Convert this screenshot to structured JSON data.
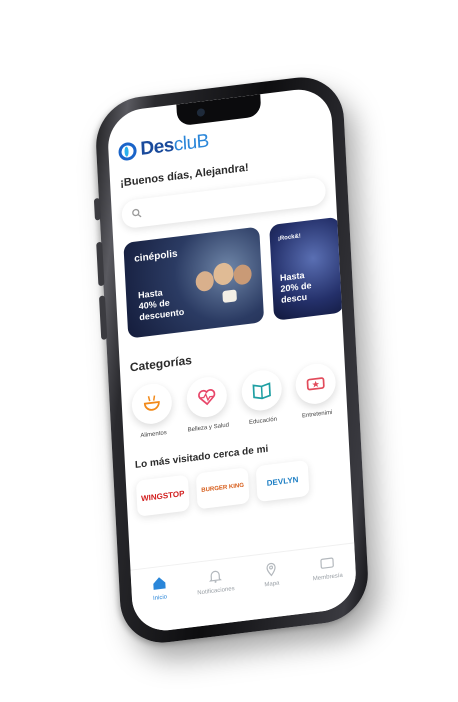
{
  "app": {
    "logo_bold": "Des",
    "logo_light": "cluB"
  },
  "greeting": "¡Buenos días, Alejandra!",
  "promos": [
    {
      "brand": "cinépolis",
      "line1": "Hasta",
      "line2": "40% de",
      "line3": "descuento"
    },
    {
      "brand": "¡Rock&!",
      "line1": "Hasta",
      "line2": "20% de",
      "line3": "descu"
    }
  ],
  "categories_title": "Categorías",
  "categories": [
    {
      "label": "Alimentos",
      "icon": "bowl-icon",
      "color": "#f28a1a"
    },
    {
      "label": "Belleza y Salud",
      "icon": "heart-pulse-icon",
      "color": "#e8476a"
    },
    {
      "label": "Educación",
      "icon": "book-icon",
      "color": "#1e9fa3"
    },
    {
      "label": "Entretenimi",
      "icon": "ticket-icon",
      "color": "#e24b5b"
    }
  ],
  "nearby_title": "Lo más visitado cerca de mi",
  "brands": [
    {
      "label": "WINGSTOP",
      "color": "#d21f1f"
    },
    {
      "label": "BURGER KING",
      "color": "#d65a16"
    },
    {
      "label": "DEVLYN",
      "color": "#1e7fc4"
    }
  ],
  "tabs": [
    {
      "label": "Inicio",
      "icon": "home-icon",
      "active": true
    },
    {
      "label": "Notificaciones",
      "icon": "bell-icon",
      "active": false
    },
    {
      "label": "Mapa",
      "icon": "map-pin-icon",
      "active": false
    },
    {
      "label": "Membresía",
      "icon": "card-icon",
      "active": false
    }
  ],
  "colors": {
    "accent": "#2a86d9",
    "brand_dark": "#1a4b9c"
  }
}
